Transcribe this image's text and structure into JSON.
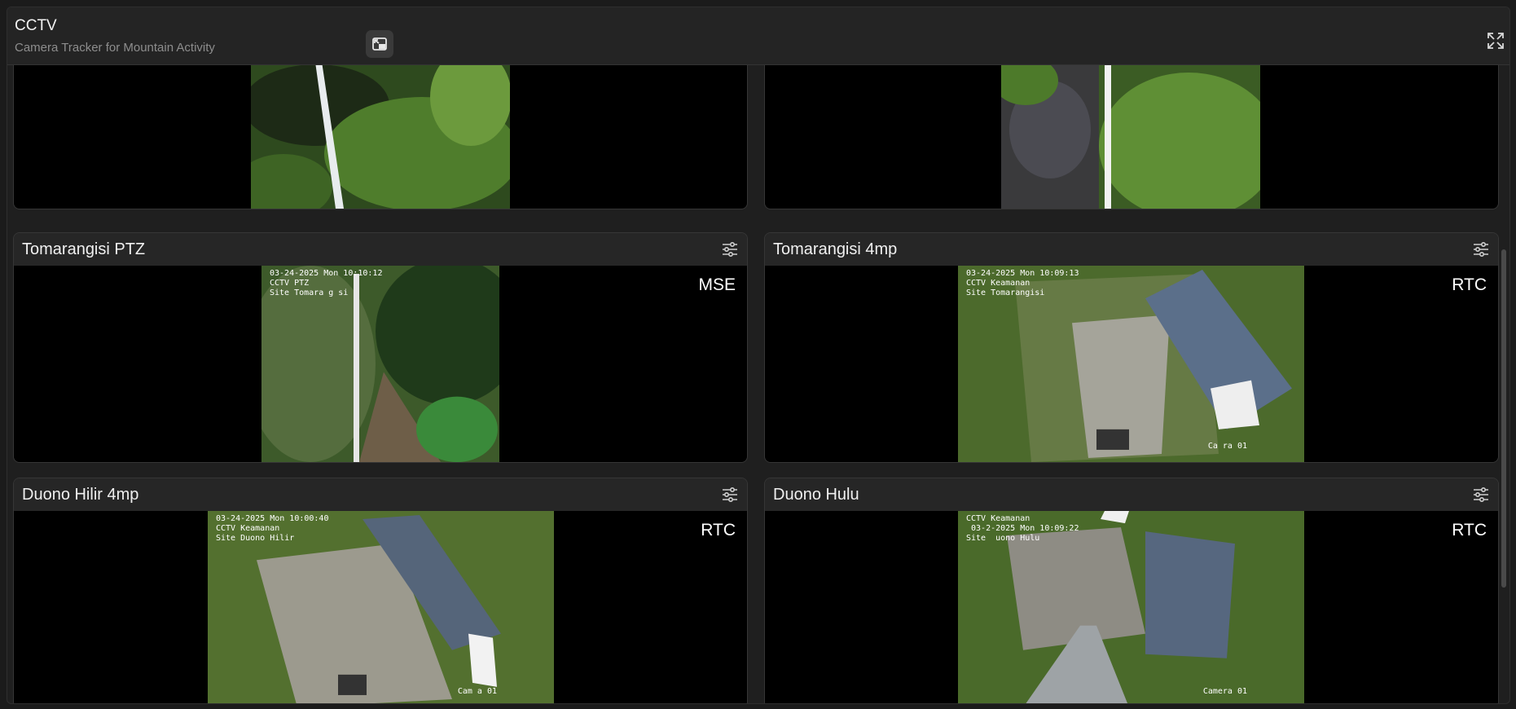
{
  "app": {
    "title": "CCTV",
    "subtitle": "Camera Tracker for Mountain Activity"
  },
  "icons": {
    "pip": "picture-in-picture-exit-icon",
    "expand": "expand-diagonal-icon",
    "settings": "sliders-settings-icon"
  },
  "colors": {
    "background": "#1b1b1b",
    "card": "#262626",
    "video_bg": "#000000"
  },
  "cameras": [
    {
      "name": "Tomarangisi PTZ",
      "mode": "MSE",
      "osd_time": "03-24-2025 Mon 10:10:12",
      "osd_line2": "CCTV PTZ",
      "osd_line3": "Site Tomara g si",
      "osd_corner": ""
    },
    {
      "name": "Tomarangisi 4mp",
      "mode": "RTC",
      "osd_time": "03-24-2025 Mon 10:09:13",
      "osd_line2": "CCTV Keamanan",
      "osd_line3": "Site Tomarangisi",
      "osd_corner": "Ca  ra 01"
    },
    {
      "name": "Duono Hilir 4mp",
      "mode": "RTC",
      "osd_time": "03-24-2025 Mon 10:00:40",
      "osd_line2": "CCTV Keamanan",
      "osd_line3": "Site Duono Hilir",
      "osd_corner": "Cam  a 01"
    },
    {
      "name": "Duono Hulu",
      "mode": "RTC",
      "osd_time": "CCTV Keamanan",
      "osd_line2": " 03-2-2025 Mon 10:09:22",
      "osd_line3": "Site  uono Hulu",
      "osd_corner": "Camera 01"
    }
  ]
}
